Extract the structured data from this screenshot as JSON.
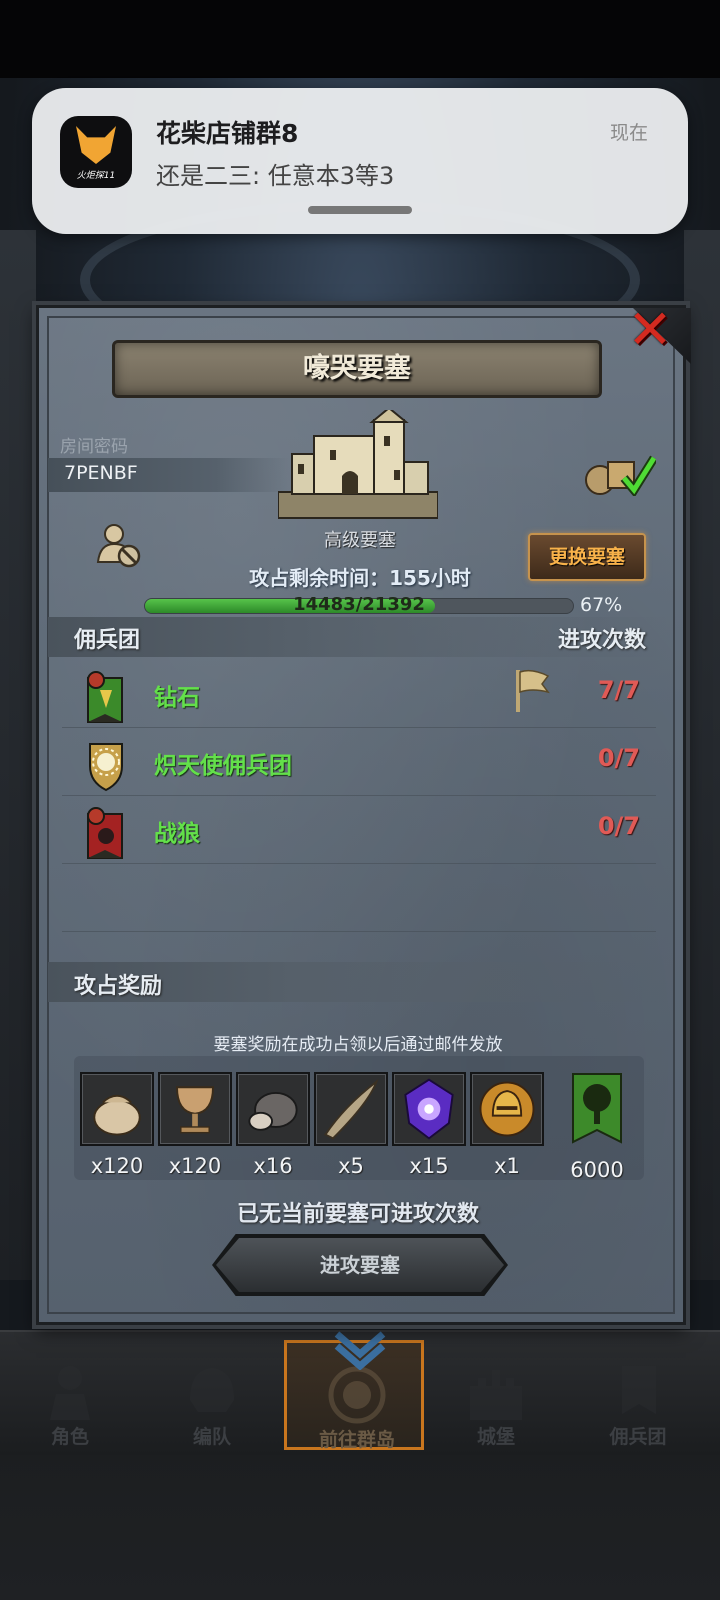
{
  "notification": {
    "app_brand": "火炬探11",
    "title": "花柴店铺群8",
    "body": "还是二三: 任意本3等3",
    "time": "现在"
  },
  "fortress": {
    "title": "嚎哭要塞",
    "room_label": "房间密码",
    "room_code": "7PENBF",
    "grade": "高级要塞",
    "timer_text": "攻占剩余时间：155小时",
    "change_button": "更换要塞",
    "progress_current": 14483,
    "progress_total": 21392,
    "progress_text": "14483/21392",
    "progress_percent_text": "67%",
    "progress_fraction": 0.677
  },
  "mercenaries": {
    "header": "佣兵团",
    "count_header": "进攻次数",
    "rows": [
      {
        "name": "钻石",
        "count": "7/7",
        "emblem": "green-banner-icon",
        "flag": true
      },
      {
        "name": "炽天使佣兵团",
        "count": "0/7",
        "emblem": "sun-shield-icon",
        "flag": false
      },
      {
        "name": "战狼",
        "count": "0/7",
        "emblem": "red-banner-icon",
        "flag": false
      }
    ]
  },
  "rewards": {
    "header": "攻占奖励",
    "note": "要塞奖励在成功占领以后通过邮件发放",
    "items": [
      {
        "icon": "sack-icon",
        "qty": "x120"
      },
      {
        "icon": "goblet-icon",
        "qty": "x120"
      },
      {
        "icon": "truffle-icon",
        "qty": "x16"
      },
      {
        "icon": "horn-icon",
        "qty": "x5"
      },
      {
        "icon": "purple-gem-icon",
        "qty": "x15"
      },
      {
        "icon": "gold-helmet-icon",
        "qty": "x1"
      },
      {
        "icon": "tree-banner-icon",
        "qty": "6000"
      }
    ]
  },
  "status_text": "已无当前要塞可进攻次数",
  "attack_button": "进攻要塞",
  "nav": {
    "items": [
      {
        "label": "角色",
        "icon": "knight-icon"
      },
      {
        "label": "编队",
        "icon": "helmet-icon"
      },
      {
        "label": "前往群岛",
        "icon": "globe-icon"
      },
      {
        "label": "城堡",
        "icon": "castle-icon"
      },
      {
        "label": "佣兵团",
        "icon": "banner-icon"
      }
    ],
    "active_index": 2
  },
  "colors": {
    "accent_orange": "#f8b24a",
    "merc_name_green": "#63e04a",
    "count_red": "#e05a56",
    "progress_green": "#3aa531"
  }
}
